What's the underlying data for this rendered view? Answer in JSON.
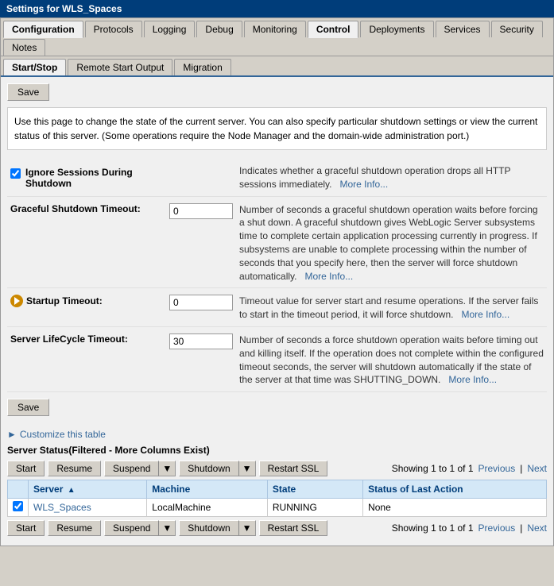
{
  "window": {
    "title": "Settings for WLS_Spaces"
  },
  "tabs": {
    "main": [
      {
        "label": "Configuration",
        "active": false
      },
      {
        "label": "Protocols",
        "active": false
      },
      {
        "label": "Logging",
        "active": false
      },
      {
        "label": "Debug",
        "active": false
      },
      {
        "label": "Monitoring",
        "active": false
      },
      {
        "label": "Control",
        "active": true
      },
      {
        "label": "Deployments",
        "active": false
      },
      {
        "label": "Services",
        "active": false
      },
      {
        "label": "Security",
        "active": false
      },
      {
        "label": "Notes",
        "active": false
      }
    ],
    "sub": [
      {
        "label": "Start/Stop",
        "active": true
      },
      {
        "label": "Remote Start Output",
        "active": false
      },
      {
        "label": "Migration",
        "active": false
      }
    ]
  },
  "buttons": {
    "save_top": "Save",
    "save_bottom": "Save",
    "start": "Start",
    "resume": "Resume",
    "suspend": "Suspend",
    "shutdown": "Shutdown",
    "restart_ssl": "Restart SSL"
  },
  "info_text": "Use this page to change the state of the current server. You can also specify particular shutdown settings or view the current status of this server. (Some operations require the Node Manager and the domain-wide administration port.)",
  "fields": {
    "ignore_sessions": {
      "label": "Ignore Sessions During Shutdown",
      "description": "Indicates whether a graceful shutdown operation drops all HTTP sessions immediately.",
      "more_info": "More Info...",
      "checked": true
    },
    "graceful_timeout": {
      "label": "Graceful Shutdown Timeout:",
      "value": "0",
      "description": "Number of seconds a graceful shutdown operation waits before forcing a shut down. A graceful shutdown gives WebLogic Server subsystems time to complete certain application processing currently in progress. If subsystems are unable to complete processing within the number of seconds that you specify here, then the server will force shutdown automatically.",
      "more_info": "More Info..."
    },
    "startup_timeout": {
      "label": "Startup Timeout:",
      "value": "0",
      "description": "Timeout value for server start and resume operations. If the server fails to start in the timeout period, it will force shutdown.",
      "more_info": "More Info..."
    },
    "lifecycle_timeout": {
      "label": "Server LifeCycle Timeout:",
      "value": "30",
      "description": "Number of seconds a force shutdown operation waits before timing out and killing itself. If the operation does not complete within the configured timeout seconds, the server will shutdown automatically if the state of the server at that time was SHUTTING_DOWN.",
      "more_info": "More Info..."
    }
  },
  "customize_link": "Customize this table",
  "server_status": {
    "title": "Server Status(Filtered - More Columns Exist)",
    "paging": {
      "showing": "Showing 1 to 1 of 1",
      "previous": "Previous",
      "next": "Next"
    },
    "columns": [
      {
        "label": "Server",
        "sortable": true
      },
      {
        "label": "Machine",
        "sortable": false
      },
      {
        "label": "State",
        "sortable": false
      },
      {
        "label": "Status of Last Action",
        "sortable": false
      }
    ],
    "rows": [
      {
        "checked": true,
        "server": "WLS_Spaces",
        "machine": "LocalMachine",
        "state": "RUNNING",
        "last_action": "None"
      }
    ]
  }
}
